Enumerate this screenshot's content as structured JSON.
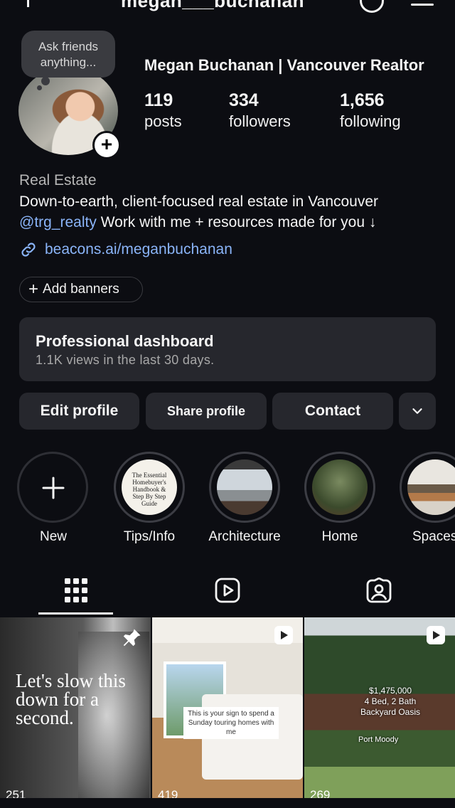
{
  "topbar": {
    "username": "megan___buchanan"
  },
  "note": {
    "text_line1": "Ask friends",
    "text_line2": "anything..."
  },
  "profile": {
    "name": "Megan Buchanan | Vancouver Realtor",
    "stats": [
      {
        "value": "119",
        "label": "posts"
      },
      {
        "value": "334",
        "label": "followers"
      },
      {
        "value": "1,656",
        "label": "following"
      }
    ],
    "category": "Real Estate",
    "bio_line1": "Down-to-earth, client-focused real estate in Vancouver",
    "bio_mention": "@trg_realty",
    "bio_line2_rest": " Work with me + resources made for you ↓",
    "link": "beacons.ai/meganbuchanan",
    "add_banners": "Add banners"
  },
  "dashboard": {
    "title": "Professional dashboard",
    "subtitle": "1.1K views in the last 30 days."
  },
  "actions": {
    "edit": "Edit profile",
    "share": "Share profile",
    "contact": "Contact"
  },
  "highlights": [
    {
      "label": "New"
    },
    {
      "label": "Tips/Info",
      "cover_text": "The Essential Homebuyer's Handbook & Step By Step Guide"
    },
    {
      "label": "Architecture"
    },
    {
      "label": "Home"
    },
    {
      "label": "Spaces"
    }
  ],
  "posts": [
    {
      "text": "Let's slow this down for a second.",
      "count": "251"
    },
    {
      "text": "This is your sign to spend a Sunday touring homes with me",
      "count": "419"
    },
    {
      "price": "$1,475,000",
      "beds": "4 Bed, 2 Bath",
      "tagline": "Backyard Oasis",
      "location": "Port Moody",
      "count": "269"
    }
  ],
  "icons": [
    "threads-icon",
    "menu-icon",
    "link-icon",
    "plus-icon",
    "chevron-down-icon",
    "grid-icon",
    "reels-icon",
    "tagged-icon",
    "pin-icon",
    "reel-icon"
  ]
}
